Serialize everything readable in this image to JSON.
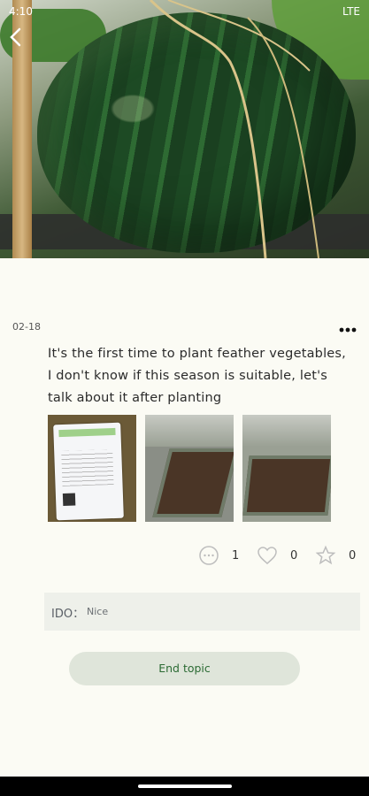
{
  "status_bar": {
    "time": "4:10",
    "network": "LTE"
  },
  "post": {
    "date": "02-18",
    "text": "It's the first time to plant feather vegetables, I don't know if this season is suitable, let's talk about it after planting",
    "stats": {
      "comments": "1",
      "likes": "0",
      "favorites": "0"
    }
  },
  "comment": {
    "author": "IDO：",
    "text": "Nice"
  },
  "actions": {
    "end_topic": "End topic"
  }
}
